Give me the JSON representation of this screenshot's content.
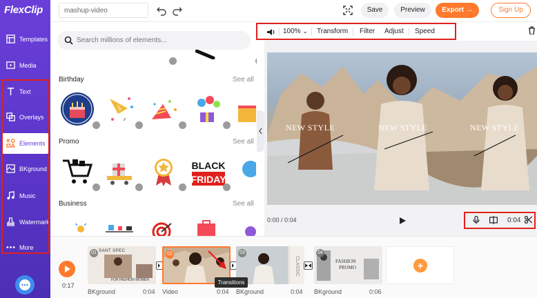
{
  "app": {
    "logo_text": "FlexClip"
  },
  "sidebar": {
    "items": [
      {
        "label": "Templates"
      },
      {
        "label": "Media"
      },
      {
        "label": "Text"
      },
      {
        "label": "Overlays"
      },
      {
        "label": "Elements"
      },
      {
        "label": "BKground"
      },
      {
        "label": "Music"
      },
      {
        "label": "Watermark"
      },
      {
        "label": "More"
      }
    ],
    "active_index": 4
  },
  "topbar": {
    "project_name": "mashup-video",
    "save_label": "Save",
    "preview_label": "Preview",
    "export_label": "Export",
    "signup_label": "Sign Up"
  },
  "panel": {
    "search_placeholder": "Search millions of elements...",
    "sections": [
      {
        "title": "Birthday",
        "see_all": "See all"
      },
      {
        "title": "Promo",
        "see_all": "See all"
      },
      {
        "title": "Business",
        "see_all": "See all"
      }
    ],
    "promo_sign": {
      "line1": "BLACK",
      "line2": "FRIDAY"
    }
  },
  "editor_toolbar": {
    "zoom": "100%",
    "transform": "Transform",
    "filter": "Filter",
    "adjust": "Adjust",
    "speed": "Speed"
  },
  "preview": {
    "overlay_texts": [
      "NEW STYLE",
      "NEW STYLE",
      "NEW STYLE"
    ],
    "time_readout": "0:00 / 0:04",
    "duration": "0:04"
  },
  "timeline": {
    "current_time": "0:17",
    "clips": [
      {
        "num": "01",
        "label": "BKground",
        "duration": "0:04",
        "caption_a": "SANT SPEC",
        "caption_b": "FOR FASHION WOMEN"
      },
      {
        "num": "02",
        "label": "Video",
        "duration": "0:04",
        "selected": true
      },
      {
        "num": "03",
        "label": "BKground",
        "duration": "0:04",
        "caption_a": "CLASSIC"
      },
      {
        "num": "04",
        "label": "BKground",
        "duration": "0:06",
        "caption_a": "FASHION",
        "caption_b": "PROMO"
      }
    ],
    "tooltip": "Transitions"
  },
  "colors": {
    "brand_purple": "#6a3fd8",
    "accent_orange": "#ff7a2e",
    "highlight_red": "#e0201c"
  }
}
